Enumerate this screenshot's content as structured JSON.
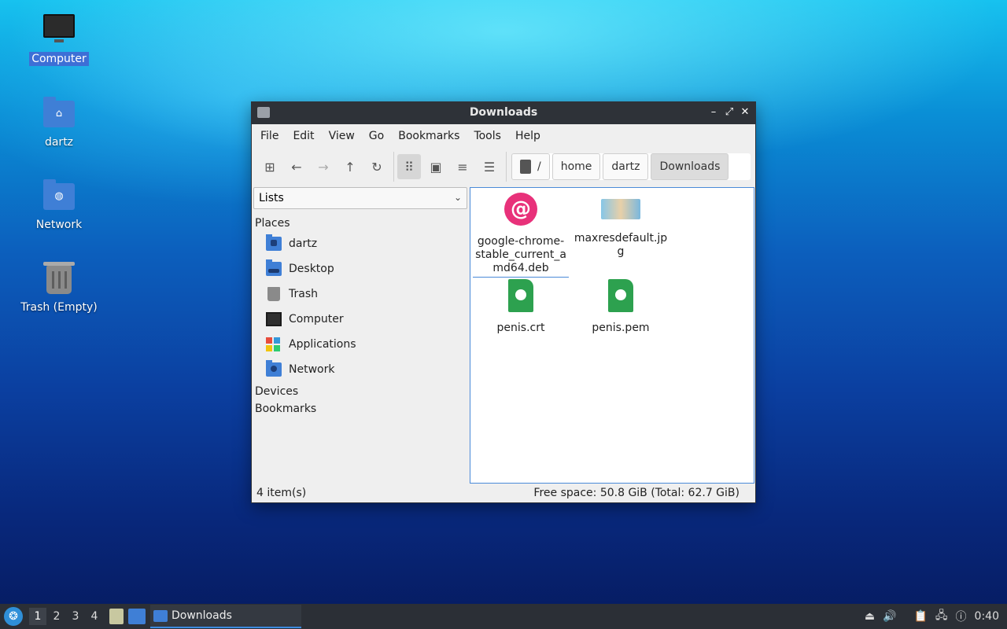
{
  "desktop": {
    "icons": [
      {
        "label": "Computer"
      },
      {
        "label": "dartz"
      },
      {
        "label": "Network"
      },
      {
        "label": "Trash (Empty)"
      }
    ]
  },
  "window": {
    "title": "Downloads",
    "menu": [
      "File",
      "Edit",
      "View",
      "Go",
      "Bookmarks",
      "Tools",
      "Help"
    ],
    "breadcrumbs": [
      "/",
      "home",
      "dartz",
      "Downloads"
    ],
    "side_pane": {
      "mode": "Lists",
      "places_label": "Places",
      "places": [
        "dartz",
        "Desktop",
        "Trash",
        "Computer",
        "Applications",
        "Network"
      ],
      "devices_label": "Devices",
      "bookmarks_label": "Bookmarks"
    },
    "files": [
      {
        "name": "google-chrome-stable_current_amd64.deb",
        "icon": "debian-package-icon",
        "lines": [
          "google-chrome-",
          "stable_current_a",
          "md64.deb"
        ]
      },
      {
        "name": "maxresdefault.jpg",
        "icon": "image-thumbnail-icon",
        "lines": [
          "maxresdefault.jp",
          "g"
        ]
      },
      {
        "name": "penis.crt",
        "icon": "certificate-icon",
        "lines": [
          "penis.crt"
        ]
      },
      {
        "name": "penis.pem",
        "icon": "certificate-icon",
        "lines": [
          "penis.pem"
        ]
      }
    ],
    "status": {
      "items": "4 item(s)",
      "space": "Free space: 50.8 GiB (Total: 62.7 GiB)"
    }
  },
  "taskbar": {
    "workspaces": [
      "1",
      "2",
      "3",
      "4"
    ],
    "active_task": "Downloads",
    "clock": "0:40"
  },
  "colors": {
    "selection": "#3d6fd6",
    "folder": "#3f7fd6",
    "titlebar": "#2e3238"
  }
}
